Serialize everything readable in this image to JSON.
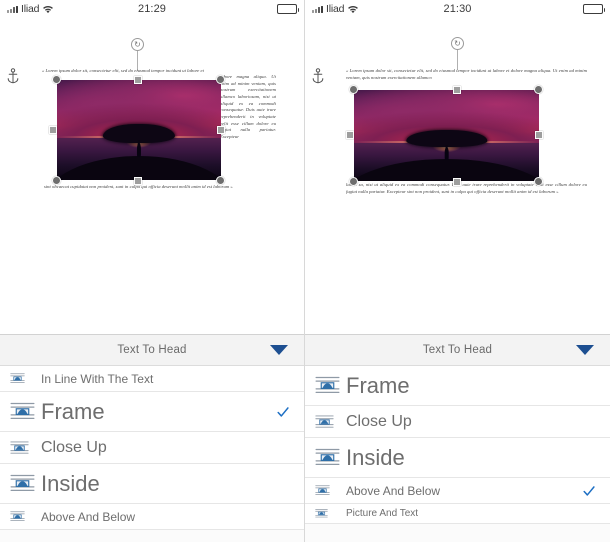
{
  "screens": [
    {
      "id": "left",
      "statusbar": {
        "carrier": "Iliad",
        "time": "21:29",
        "signal_icon": "cellular-signal-icon",
        "wifi_icon": "wifi-icon",
        "battery_icon": "battery-icon"
      },
      "canvas": {
        "anchor_icon": "anchor-icon",
        "rotate_icon": "rotate-handle-icon",
        "text_top": "« Lorem ipsum dolor sit, consectetur elit, sed do eiusmod tempor incidunt ut labore et",
        "text_side": "labore magna aliqua. Ut enim ad minim veniam, quis nostrum exercitationem ullamco laboriosam, nisi ut aliquid ex ea commodi consequatur. Duis aute irure reprehenderit in voluptate velit esse cillum dolore eu fugiat nulla pariatur. Excepteur",
        "text_bottom": "sint obcaecat cupidatat non proident, sunt in culpa qui officia deserunt mollit anim id est laborum »",
        "image_alt": "sunset-tree-photo"
      },
      "sheet": {
        "title": "Text To Head",
        "dropdown_icon": "chevron-down-icon",
        "options": [
          {
            "label": "In Line With The Text",
            "icon": "wrap-inline-icon",
            "selected": false,
            "size": "small"
          },
          {
            "label": "Frame",
            "icon": "wrap-frame-icon",
            "selected": true,
            "size": "large"
          },
          {
            "label": "Close Up",
            "icon": "wrap-closeup-icon",
            "selected": false,
            "size": "medium"
          },
          {
            "label": "Inside",
            "icon": "wrap-inside-icon",
            "selected": false,
            "size": "large"
          },
          {
            "label": "Above And Below",
            "icon": "wrap-abovebelow-icon",
            "selected": false,
            "size": "small"
          }
        ]
      }
    },
    {
      "id": "right",
      "statusbar": {
        "carrier": "Iliad",
        "time": "21:30",
        "signal_icon": "cellular-signal-icon",
        "wifi_icon": "wifi-icon",
        "battery_icon": "battery-icon"
      },
      "canvas": {
        "anchor_icon": "anchor-icon",
        "rotate_icon": "rotate-handle-icon",
        "text_top": "« Lorem ipsum dolor sit, consectetur elit, sed do eiusmod tempor incidunt ut labore et dolore magna aliqua. Ut enim ad minim veniam, quis nostrum exercitationem ullamco",
        "text_bottom": "labor. sa, nisi ut aliquid ex ea commodi consequatur. Duis aute irure reprehenderit in voluptate velit esse cillum dolore eu fugiat nulla pariatur. Excepteur sint non proident, sunt in culpa qui officia deserunt mollit anim id est laborum »",
        "image_alt": "sunset-tree-photo"
      },
      "sheet": {
        "title": "Text To Head",
        "dropdown_icon": "chevron-down-icon",
        "options": [
          {
            "label": "Frame",
            "icon": "wrap-frame-icon",
            "selected": false,
            "size": "large"
          },
          {
            "label": "Close Up",
            "icon": "wrap-closeup-icon",
            "selected": false,
            "size": "medium"
          },
          {
            "label": "Inside",
            "icon": "wrap-inside-icon",
            "selected": false,
            "size": "large"
          },
          {
            "label": "Above And Below",
            "icon": "wrap-abovebelow-icon",
            "selected": true,
            "size": "small"
          },
          {
            "label": "Picture And Text",
            "icon": "wrap-pictext-icon",
            "selected": false,
            "size": "tiny"
          }
        ]
      }
    }
  ],
  "colors": {
    "accent": "#1d6fc4",
    "chevron": "#1d4f91",
    "text_muted": "#6e6e6e",
    "divider": "#e6e6e6"
  }
}
